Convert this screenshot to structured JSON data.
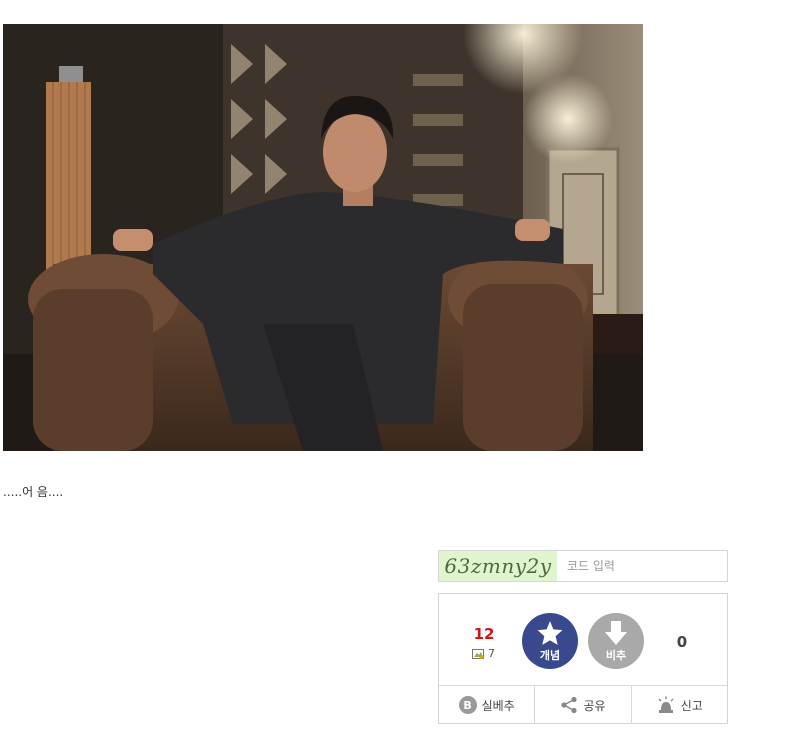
{
  "post": {
    "caption": ".....어 음...."
  },
  "captcha": {
    "code": "63zmny2y",
    "placeholder": "코드 입력"
  },
  "votes": {
    "up_count": "12",
    "sub_count": "7",
    "up_label": "개념",
    "down_label": "비추",
    "down_count": "0",
    "accent_up": "#39498e",
    "accent_down": "#a9a9a9"
  },
  "actions": {
    "best_badge": "B",
    "best_label": "실베추",
    "share_label": "공유",
    "report_label": "신고"
  },
  "icons": [
    "star-icon",
    "arrow-down-icon",
    "share-icon",
    "siren-icon",
    "image-icon"
  ]
}
